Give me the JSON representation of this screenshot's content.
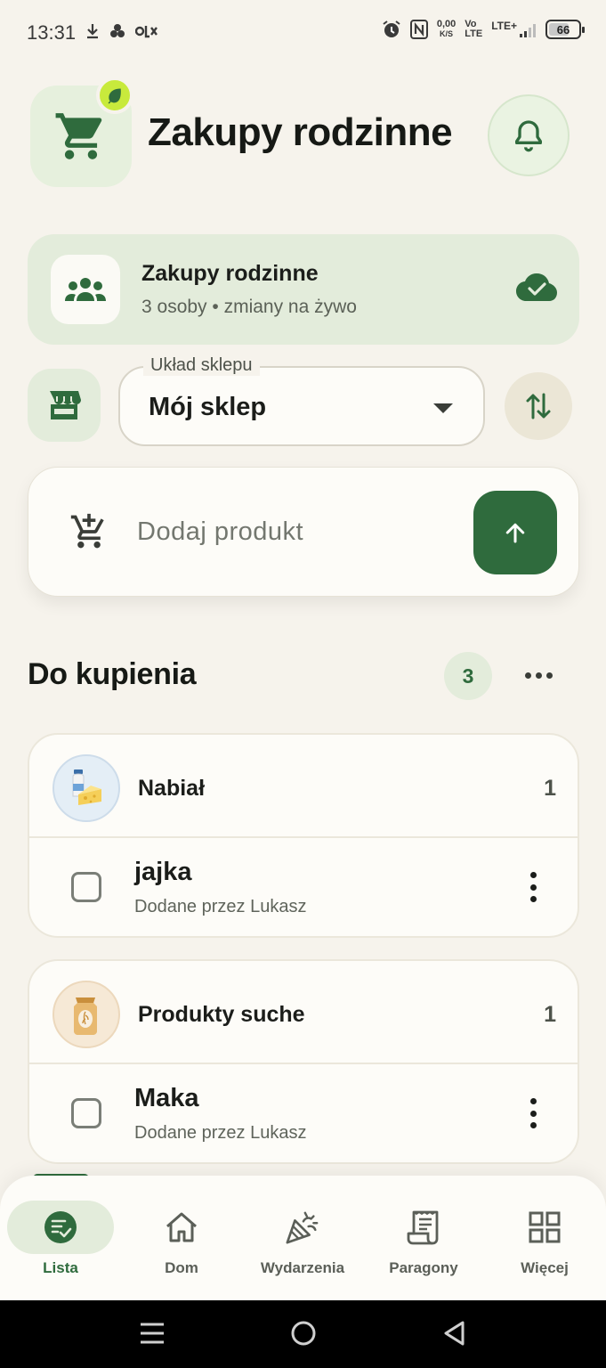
{
  "status_bar": {
    "time": "13:31",
    "net_speed_top": "0,00",
    "net_speed_bottom": "K/S",
    "volte_top": "Vo",
    "volte_bottom": "LTE",
    "lte_label": "LTE+",
    "battery": "66"
  },
  "header": {
    "title": "Zakupy rodzinne"
  },
  "group": {
    "name": "Zakupy rodzinne",
    "subtitle": "3 osoby • zmiany na żywo"
  },
  "layout": {
    "label": "Układ sklepu",
    "value": "Mój sklep"
  },
  "add_product": {
    "placeholder": "Dodaj produkt"
  },
  "section": {
    "title": "Do kupienia",
    "count": "3"
  },
  "categories": [
    {
      "name": "Nabiał",
      "count": "1",
      "items": [
        {
          "name": "jajka",
          "added_by": "Dodane przez Lukasz"
        }
      ]
    },
    {
      "name": "Produkty suche",
      "count": "1",
      "items": [
        {
          "name": "Maka",
          "added_by": "Dodane przez Lukasz"
        }
      ]
    }
  ],
  "bottom_nav": [
    {
      "label": "Lista",
      "icon": "list-check-icon",
      "active": true
    },
    {
      "label": "Dom",
      "icon": "home-icon"
    },
    {
      "label": "Wydarzenia",
      "icon": "party-popper-icon"
    },
    {
      "label": "Paragony",
      "icon": "receipt-icon"
    },
    {
      "label": "Więcej",
      "icon": "grid-icon"
    }
  ],
  "colors": {
    "background": "#f6f3ec",
    "accent": "#2f6b3d",
    "accent_light": "#e3ecdb",
    "badge": "#c8ea3c"
  }
}
